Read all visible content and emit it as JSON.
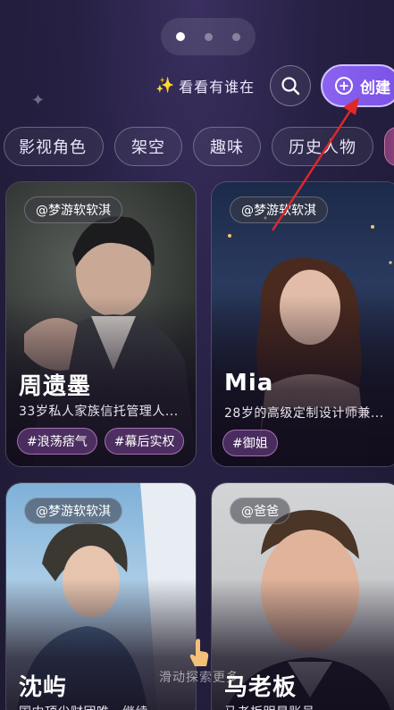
{
  "header": {
    "see_who_label": "看看有谁在",
    "create_label": "创建"
  },
  "categories": [
    "影视角色",
    "架空",
    "趣味",
    "历史人物"
  ],
  "cards": [
    {
      "author": "@梦游软软淇",
      "name": "周遗墨",
      "desc": "33岁私人家族信托管理人...",
      "tags": [
        "#浪荡痞气",
        "#幕后实权"
      ]
    },
    {
      "author": "@梦游软软淇",
      "name": "Mia",
      "desc": "28岁的高级定制设计师兼...",
      "tags": [
        "#御姐"
      ]
    },
    {
      "author": "@梦游软软淇",
      "name": "沈屿",
      "desc": "国内顶尖财团唯一继续...",
      "tags": []
    },
    {
      "author": "@爸爸",
      "name": "马老板",
      "desc": "马老板明星账号...",
      "tags": []
    }
  ],
  "swipe_hint": "滑动探索更多",
  "colors": {
    "accent": "#8b63f0",
    "background": "#221d3a",
    "annotation": "#e0282a"
  }
}
